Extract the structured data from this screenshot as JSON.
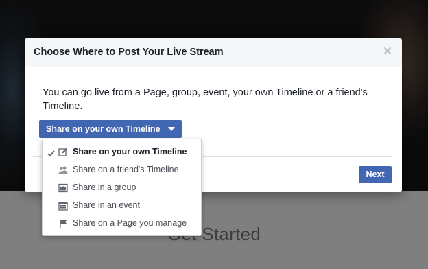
{
  "background": {
    "get_started": "Get Started"
  },
  "dialog": {
    "title": "Choose Where to Post Your Live Stream",
    "description": "You can go live from a Page, group, event, your own Timeline or a friend's Timeline.",
    "audience_button_label": "Share on your own Timeline",
    "next_label": "Next",
    "close_icon": "close-icon"
  },
  "menu": {
    "items": [
      {
        "label": "Share on your own Timeline",
        "icon": "compose-icon",
        "selected": true
      },
      {
        "label": "Share on a friend's Timeline",
        "icon": "friends-icon",
        "selected": false
      },
      {
        "label": "Share in a group",
        "icon": "group-icon",
        "selected": false
      },
      {
        "label": "Share in an event",
        "icon": "calendar-icon",
        "selected": false
      },
      {
        "label": "Share on a Page you manage",
        "icon": "flag-icon",
        "selected": false
      }
    ]
  },
  "colors": {
    "accent": "#4267b2",
    "header_bg": "#f5f6f7",
    "text": "#1d2129"
  }
}
